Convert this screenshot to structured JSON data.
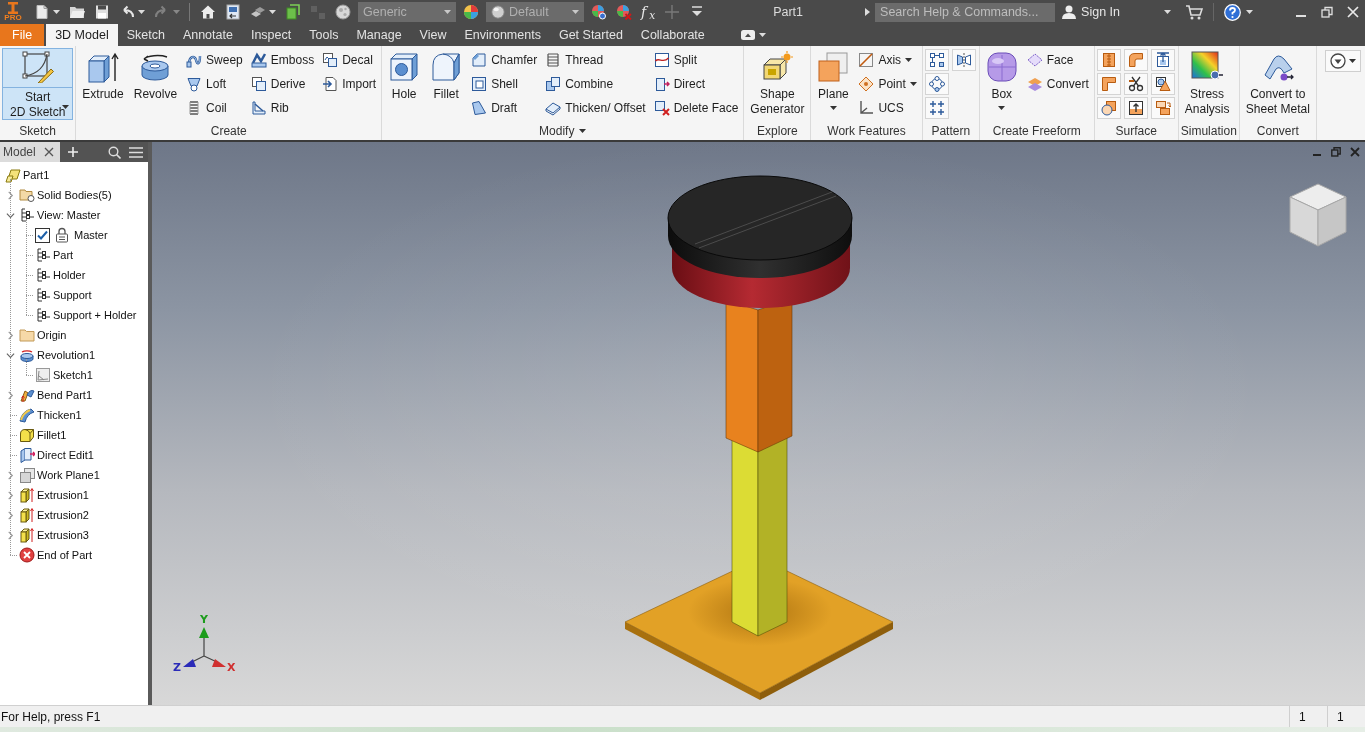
{
  "app_bar": {
    "logo_badge": "PRO",
    "quick_access": [
      {
        "kind": "new",
        "dropdown": true,
        "disabled": false
      },
      {
        "kind": "open",
        "dropdown": false,
        "disabled": false
      },
      {
        "kind": "save",
        "dropdown": false,
        "disabled": false
      },
      {
        "kind": "undo",
        "dropdown": true,
        "disabled": false
      },
      {
        "kind": "redo",
        "dropdown": true,
        "disabled": true
      },
      {
        "kind": "separator"
      },
      {
        "kind": "home",
        "dropdown": false,
        "disabled": false
      },
      {
        "kind": "return",
        "dropdown": false,
        "disabled": false
      },
      {
        "kind": "select",
        "dropdown": true,
        "disabled": false
      },
      {
        "kind": "update",
        "dropdown": false,
        "disabled": false
      },
      {
        "kind": "boxes",
        "dropdown": false,
        "disabled": true
      },
      {
        "kind": "material",
        "dropdown": false,
        "disabled": false
      },
      {
        "kind": "combo",
        "value": "Generic"
      },
      {
        "kind": "appearance",
        "dropdown": false,
        "disabled": false
      },
      {
        "kind": "swatchcombo",
        "value": "Default"
      },
      {
        "kind": "adjust",
        "dropdown": false,
        "disabled": false
      },
      {
        "kind": "clear",
        "dropdown": false,
        "disabled": false
      },
      {
        "kind": "fx",
        "label": "f$_{x}$",
        "dropdown": false,
        "disabled": false
      },
      {
        "kind": "plus",
        "dropdown": false,
        "disabled": true
      },
      {
        "kind": "customize",
        "dropdown": false,
        "disabled": false
      }
    ],
    "title": "Part1",
    "search": {
      "placeholder": "Search Help & Commands..."
    },
    "sign_in": "Sign In"
  },
  "tabs": [
    {
      "label": "File",
      "kind": "file",
      "selected": false
    },
    {
      "label": "3D Model",
      "kind": "tab",
      "selected": true
    },
    {
      "label": "Sketch",
      "kind": "tab",
      "selected": false
    },
    {
      "label": "Annotate",
      "kind": "tab",
      "selected": false
    },
    {
      "label": "Inspect",
      "kind": "tab",
      "selected": false
    },
    {
      "label": "Tools",
      "kind": "tab",
      "selected": false
    },
    {
      "label": "Manage",
      "kind": "tab",
      "selected": false
    },
    {
      "label": "View",
      "kind": "tab",
      "selected": false
    },
    {
      "label": "Environments",
      "kind": "tab",
      "selected": false
    },
    {
      "label": "Get Started",
      "kind": "tab",
      "selected": false
    },
    {
      "label": "Collaborate",
      "kind": "tab",
      "selected": false
    }
  ],
  "ribbon": {
    "panels": [
      {
        "label": "Sketch",
        "menu": false,
        "large": [
          {
            "label": "Start\n2D Sketch",
            "kind": "sketch",
            "dropdown": true,
            "highlighted": true
          }
        ]
      },
      {
        "label": "Create",
        "menu": false,
        "large": [
          {
            "label": "Extrude",
            "kind": "extrude",
            "dropdown": false,
            "highlighted": false
          },
          {
            "label": "Revolve",
            "kind": "revolve",
            "dropdown": false,
            "highlighted": false
          }
        ],
        "columns": [
          [
            {
              "label": "Sweep",
              "kind": "sweep",
              "dropdown": false
            },
            {
              "label": "Loft",
              "kind": "loft",
              "dropdown": false
            },
            {
              "label": "Coil",
              "kind": "coil",
              "dropdown": false
            }
          ],
          [
            {
              "label": "Emboss",
              "kind": "emboss",
              "dropdown": false
            },
            {
              "label": "Derive",
              "kind": "derive",
              "dropdown": false
            },
            {
              "label": "Rib",
              "kind": "rib",
              "dropdown": false
            }
          ],
          [
            {
              "label": "Decal",
              "kind": "decal",
              "dropdown": false
            },
            {
              "label": "Import",
              "kind": "import",
              "dropdown": false
            }
          ]
        ]
      },
      {
        "label": "Modify",
        "menu": true,
        "large": [
          {
            "label": "Hole",
            "kind": "hole",
            "dropdown": false,
            "highlighted": false
          },
          {
            "label": "Fillet",
            "kind": "fillet",
            "dropdown": false,
            "highlighted": false
          }
        ],
        "columns": [
          [
            {
              "label": "Chamfer",
              "kind": "chamfer",
              "dropdown": false
            },
            {
              "label": "Shell",
              "kind": "shell",
              "dropdown": false
            },
            {
              "label": "Draft",
              "kind": "draft",
              "dropdown": false
            }
          ],
          [
            {
              "label": "Thread",
              "kind": "thread",
              "dropdown": false
            },
            {
              "label": "Combine",
              "kind": "combine",
              "dropdown": false
            },
            {
              "label": "Thicken/ Offset",
              "kind": "thicken",
              "dropdown": false
            }
          ],
          [
            {
              "label": "Split",
              "kind": "split",
              "dropdown": false
            },
            {
              "label": "Direct",
              "kind": "direct",
              "dropdown": false
            },
            {
              "label": "Delete Face",
              "kind": "deleteface",
              "dropdown": false
            }
          ]
        ]
      },
      {
        "label": "Explore",
        "menu": false,
        "large": [
          {
            "label": "Shape\nGenerator",
            "kind": "shapegen",
            "dropdown": false,
            "highlighted": false
          }
        ]
      },
      {
        "label": "Work Features",
        "menu": false,
        "large": [
          {
            "label": "Plane",
            "kind": "plane",
            "dropdown": true,
            "highlighted": false
          }
        ],
        "columns": [
          [
            {
              "label": "Axis",
              "kind": "axis",
              "dropdown": true
            },
            {
              "label": "Point",
              "kind": "point",
              "dropdown": true
            },
            {
              "label": "UCS",
              "kind": "ucs",
              "dropdown": false
            }
          ]
        ]
      },
      {
        "label": "Pattern",
        "menu": false,
        "columns": [
          [
            {
              "kind": "rectpattern",
              "dropdown": false
            },
            {
              "kind": "circpattern",
              "dropdown": false
            },
            {
              "kind": "sketchpattern",
              "dropdown": false
            }
          ],
          [
            {
              "kind": "mirror",
              "dropdown": false
            }
          ]
        ]
      },
      {
        "label": "Create Freeform",
        "menu": false,
        "large": [
          {
            "label": "Box",
            "kind": "freeformbox",
            "dropdown": true,
            "highlighted": false
          }
        ],
        "columns": [
          [
            {
              "label": "Face",
              "kind": "face",
              "dropdown": false
            },
            {
              "label": "Convert",
              "kind": "convert",
              "dropdown": false
            }
          ]
        ]
      },
      {
        "label": "Surface",
        "menu": false,
        "columns": [
          [
            {
              "kind": "ribbed",
              "dropdown": false
            },
            {
              "kind": "lshape",
              "dropdown": false
            },
            {
              "kind": "circlesquare",
              "dropdown": false
            }
          ],
          [
            {
              "kind": "curved",
              "dropdown": false
            },
            {
              "kind": "scissors",
              "dropdown": false
            },
            {
              "kind": "uparrow",
              "dropdown": false
            }
          ],
          [
            {
              "kind": "boxarrow",
              "dropdown": false
            },
            {
              "kind": "overlap",
              "dropdown": false
            },
            {
              "kind": "stacked",
              "dropdown": false
            }
          ]
        ]
      },
      {
        "label": "Simulation",
        "menu": false,
        "large": [
          {
            "label": "Stress\nAnalysis",
            "kind": "stress",
            "dropdown": false,
            "highlighted": false
          }
        ]
      },
      {
        "label": "Convert",
        "menu": false,
        "large": [
          {
            "label": "Convert to\nSheet Metal",
            "kind": "sheetmetal",
            "dropdown": false,
            "highlighted": false
          }
        ]
      }
    ]
  },
  "browser": {
    "tab": "Model",
    "tree": [
      {
        "label": "Part1",
        "kind": "part",
        "children": [
          {
            "label": "Solid Bodies(5)",
            "kind": "bodies",
            "expanded": false
          },
          {
            "label": "View: Master",
            "kind": "view",
            "expanded": true,
            "children": [
              {
                "label": "Master",
                "kind": "viewrep",
                "checked": true,
                "locked": true
              },
              {
                "label": "Part",
                "kind": "view"
              },
              {
                "label": "Holder",
                "kind": "view"
              },
              {
                "label": "Support",
                "kind": "view"
              },
              {
                "label": "Support + Holder",
                "kind": "view"
              }
            ]
          },
          {
            "label": "Origin",
            "kind": "folder",
            "expanded": false
          },
          {
            "label": "Revolution1",
            "kind": "revolve",
            "expanded": true,
            "children": [
              {
                "label": "Sketch1",
                "kind": "sketch"
              }
            ]
          },
          {
            "label": "Bend Part1",
            "kind": "bend",
            "expanded": false
          },
          {
            "label": "Thicken1",
            "kind": "thicken"
          },
          {
            "label": "Fillet1",
            "kind": "fillet"
          },
          {
            "label": "Direct Edit1",
            "kind": "direct"
          },
          {
            "label": "Work Plane1",
            "kind": "workplane",
            "expanded": false
          },
          {
            "label": "Extrusion1",
            "kind": "extrusion",
            "expanded": false
          },
          {
            "label": "Extrusion2",
            "kind": "extrusion",
            "expanded": false
          },
          {
            "label": "Extrusion3",
            "kind": "extrusion",
            "expanded": false
          },
          {
            "label": "End of Part",
            "kind": "end"
          }
        ]
      }
    ]
  },
  "viewport": {
    "axes": [
      {
        "label": "Y",
        "color": "#1c9c1c"
      },
      {
        "label": "Z",
        "color": "#2b2bb8"
      },
      {
        "label": "X",
        "color": "#d03030"
      }
    ]
  },
  "status_bar": {
    "message": "For Help, press F1",
    "fields": [
      "1",
      "1"
    ]
  }
}
